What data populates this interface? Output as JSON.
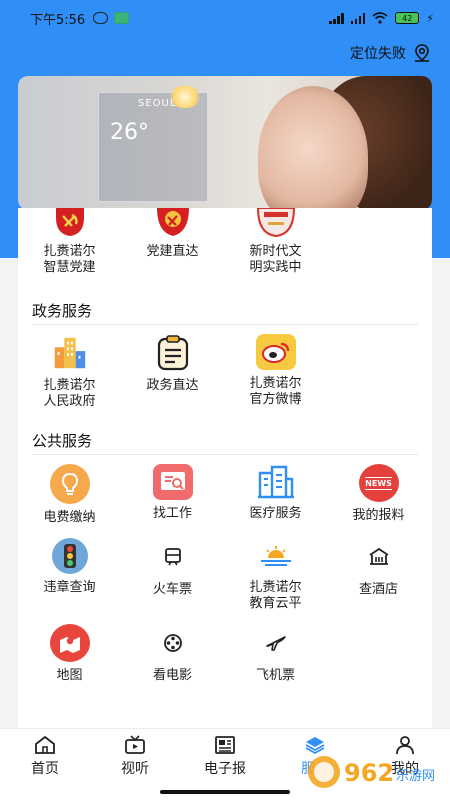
{
  "status_bar": {
    "time": "下午5:56",
    "battery": "42"
  },
  "header": {
    "location_label": "定位失败"
  },
  "banner": {
    "city": "SEOUL",
    "temperature": "26°"
  },
  "party_section": {
    "items": [
      {
        "label": "扎赉诺尔\n智慧党建",
        "icon": "party-emblem-icon"
      },
      {
        "label": "党建直达",
        "icon": "party-emblem-icon"
      },
      {
        "label": "新时代文\n明实践中",
        "icon": "civilization-badge-icon"
      }
    ]
  },
  "government_services": {
    "title": "政务服务",
    "items": [
      {
        "label": "扎赉诺尔\n人民政府",
        "icon": "buildings-icon"
      },
      {
        "label": "政务直达",
        "icon": "clipboard-icon"
      },
      {
        "label": "扎赉诺尔\n官方微博",
        "icon": "weibo-icon"
      }
    ]
  },
  "public_services": {
    "title": "公共服务",
    "items": [
      {
        "label": "电费缴纳",
        "icon": "lightbulb-icon"
      },
      {
        "label": "找工作",
        "icon": "job-search-icon"
      },
      {
        "label": "医疗服务",
        "icon": "hospital-icon"
      },
      {
        "label": "我的报料",
        "icon": "news-icon"
      },
      {
        "label": "违章查询",
        "icon": "traffic-light-icon"
      },
      {
        "label": "火车票",
        "icon": "train-icon"
      },
      {
        "label": "扎赉诺尔\n教育云平",
        "icon": "sunrise-icon"
      },
      {
        "label": "查酒店",
        "icon": "hotel-icon"
      },
      {
        "label": "地图",
        "icon": "map-icon"
      },
      {
        "label": "看电影",
        "icon": "film-reel-icon"
      },
      {
        "label": "飞机票",
        "icon": "airplane-icon"
      }
    ]
  },
  "tabbar": {
    "tabs": [
      {
        "label": "首页",
        "icon": "home-icon"
      },
      {
        "label": "视听",
        "icon": "tv-icon"
      },
      {
        "label": "电子报",
        "icon": "newspaper-icon"
      },
      {
        "label": "服务",
        "icon": "layers-icon",
        "active": true
      },
      {
        "label": "我的",
        "icon": "user-icon"
      }
    ]
  },
  "watermark": {
    "text": "962",
    "sub": "乐游网"
  },
  "colors": {
    "brand_blue": "#2f8ff6",
    "active_tab": "#2f8ff6"
  }
}
